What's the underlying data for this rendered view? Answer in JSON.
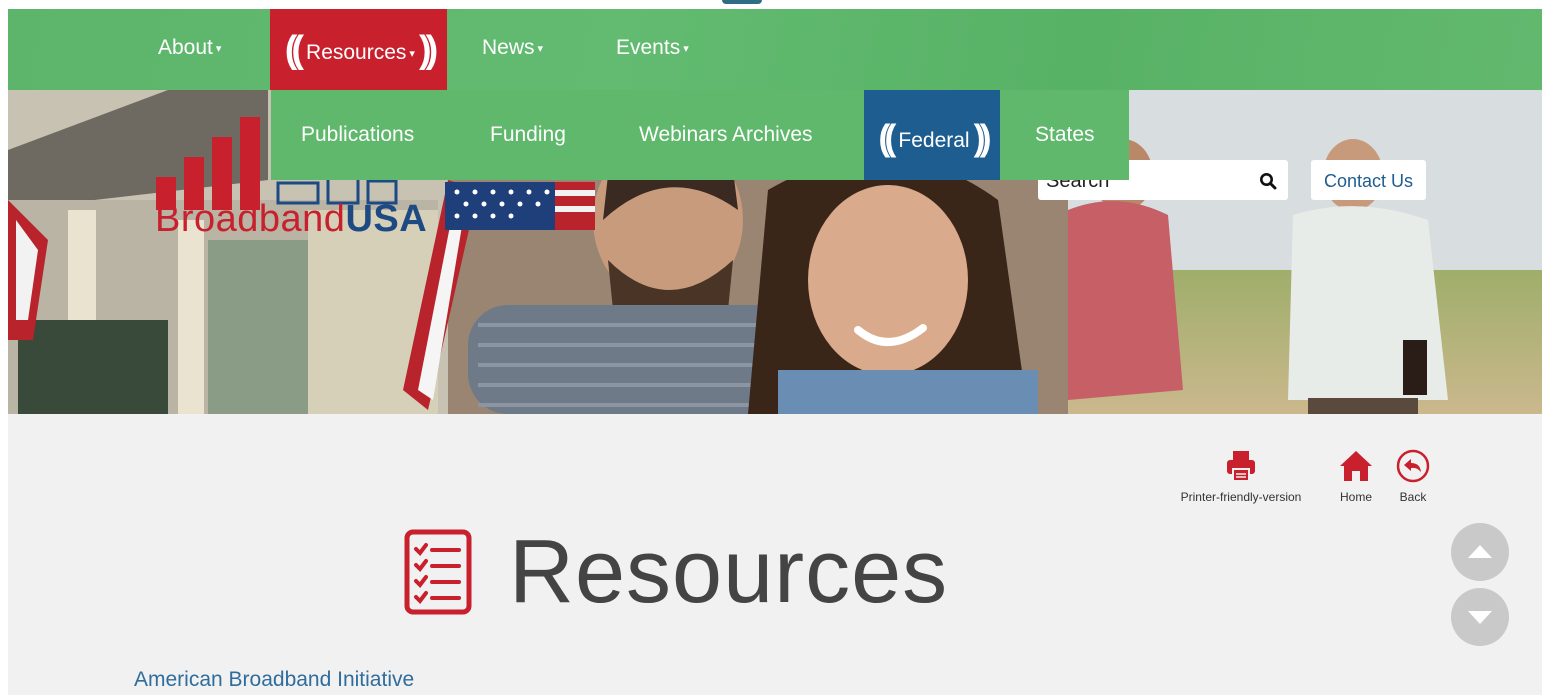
{
  "nav": {
    "about": "About",
    "resources": "Resources",
    "news": "News",
    "events": "Events",
    "caret": "▾"
  },
  "dropdown": {
    "items": [
      "Publications",
      "Funding",
      "Webinars Archives",
      "Federal",
      "States"
    ],
    "active": "Federal"
  },
  "logo": {
    "part1": "Broadband",
    "part2": "USA"
  },
  "search": {
    "placeholder": "Search"
  },
  "contact": {
    "label": "Contact Us"
  },
  "utility": {
    "print": "Printer-friendly-version",
    "home": "Home",
    "back": "Back"
  },
  "page": {
    "title": "Resources",
    "first_link": "American Broadband Initiative"
  },
  "colors": {
    "nav_green": "#5fb86c",
    "active_red": "#c8202d",
    "federal_blue": "#1e5d8f",
    "link_blue": "#2f6d9c"
  }
}
